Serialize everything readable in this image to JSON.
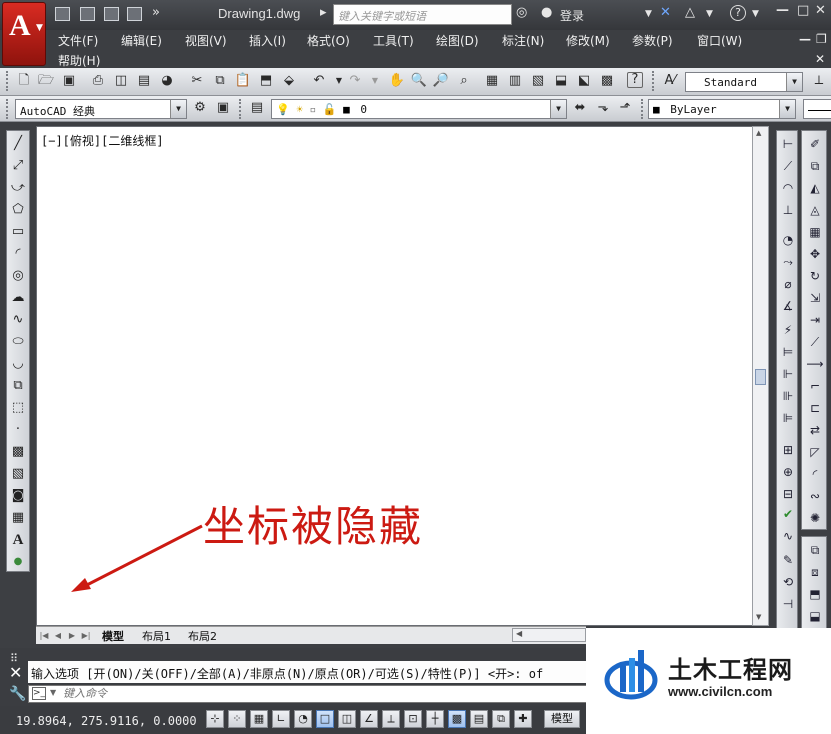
{
  "titlebar": {
    "doc_title": "Drawing1.dwg",
    "search_placeholder": "键入关键字或短语",
    "login_label": "登录",
    "help_label": "?"
  },
  "menu": {
    "row1": [
      "文件(F)",
      "编辑(E)",
      "视图(V)",
      "插入(I)",
      "格式(O)",
      "工具(T)",
      "绘图(D)",
      "标注(N)",
      "修改(M)",
      "参数(P)",
      "窗口(W)"
    ],
    "row2": [
      "帮助(H)"
    ]
  },
  "toolbar": {
    "text_style": "Standard",
    "workspace": "AutoCAD 经典",
    "layer": "0",
    "color": "ByLayer"
  },
  "canvas": {
    "viewport_label": "[−][俯视][二维线框]",
    "annotation": "坐标被隐藏",
    "annotation_color": "#cc1a12"
  },
  "layout_tabs": [
    "模型",
    "布局1",
    "布局2"
  ],
  "command": {
    "history": "输入选项 [开(ON)/关(OFF)/全部(A)/非原点(N)/原点(OR)/可选(S)/特性(P)] <开>: of",
    "input_placeholder": "键入命令"
  },
  "status": {
    "coords": "19.8964,  275.9116, 0.0000",
    "model_label": "模型"
  },
  "watermark": {
    "title": "土木工程网",
    "url": "www.civilcn.com"
  },
  "colors": {
    "accent_red": "#d92b22",
    "chrome_dark": "#3c3e42"
  }
}
